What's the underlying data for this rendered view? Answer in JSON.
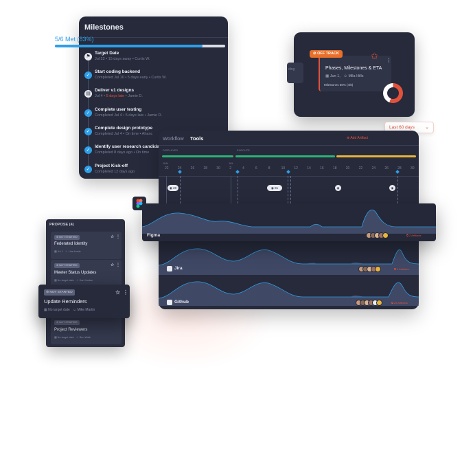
{
  "milestones": {
    "title": "Milestones",
    "met_label": "5/6 Met (83%)",
    "met_fraction": 0.83,
    "items": [
      {
        "title": "Target Date",
        "sub": "Jul 22 • 15 days away • Curtis W.",
        "icon": "flag-icon",
        "done": false
      },
      {
        "title": "Start coding backend",
        "sub": "Completed Jul 10 • 5 days early • Curtis W.",
        "icon": "check-icon",
        "done": true
      },
      {
        "title": "Deliver v1 designs",
        "sub_pre": "Jul 4 • ",
        "sub_red": "5 days late",
        "sub_post": " • Jamie D.",
        "icon": "doc-icon",
        "done": false
      },
      {
        "title": "Complete user testing",
        "sub": "Completed Jul 4 • 5 days late • Jamie D.",
        "icon": "check-icon",
        "done": true
      },
      {
        "title": "Complete design prototype",
        "sub": "Completed Jul 4 • On time • Ahanc",
        "icon": "check-icon",
        "done": true
      },
      {
        "title": "Identify user research candidates",
        "sub": "Completed 8 days ago • On time",
        "icon": "check-icon",
        "done": true
      },
      {
        "title": "Project Kick-off",
        "sub": "Completed 12 days ago",
        "icon": "check-icon",
        "done": true
      }
    ]
  },
  "phases_card": {
    "status": "OFF TRACK",
    "title": "Phases, Milestones & ETA",
    "date": "Jun 1,",
    "owner": "Mila Hills",
    "milestones": "Milestones 56% (4/8)",
    "progress_fraction": 0.56,
    "ghost_text": "ding"
  },
  "date_range": {
    "value": "Last 60 days"
  },
  "timeline": {
    "tabs": [
      {
        "label": "Workflow",
        "active": false
      },
      {
        "label": "Tools",
        "active": true
      }
    ],
    "add_artifact": "Add Artifact",
    "phases": [
      "DISPLAYED",
      "EXECUTE"
    ],
    "month_labels": [
      "JUN",
      "JUL"
    ],
    "ticks": [
      "22",
      "24",
      "26",
      "28",
      "30",
      "2",
      "4",
      "6",
      "8",
      "10",
      "12",
      "14",
      "16",
      "18",
      "20",
      "22",
      "24",
      "26",
      "28",
      "30"
    ],
    "pins": [
      "20",
      "81"
    ],
    "tools": [
      {
        "name": "Figma",
        "issues": "2 Artifacts"
      },
      {
        "name": "Jira",
        "issues": "4 Artifacts"
      },
      {
        "name": "Github",
        "issues": "25 Artifacts"
      }
    ]
  },
  "propose": {
    "header": "PROPOSE",
    "count": "(4)",
    "cards": [
      {
        "status": "NOT STARTED",
        "name": "Federated Identity",
        "date": "Jul 1",
        "owner": "Lisa Lewis"
      },
      {
        "status": "NOT STARTED",
        "name": "Meeter Status Updates",
        "date": "No target date",
        "owner": "Karl Jordan"
      },
      {
        "status": "NOT STARTED",
        "name": "Update Reminders",
        "date": "No target date",
        "owner": "Mike Martin"
      },
      {
        "status": "NOT STARTED",
        "name": "Project Reviewers",
        "date": "No target date",
        "owner": "Ben Walk"
      }
    ]
  },
  "colors": {
    "accent": "#2e9ee8",
    "danger": "#e2513b",
    "warning": "#e8b43a",
    "success": "#2bb377",
    "panel": "#262a3b"
  }
}
